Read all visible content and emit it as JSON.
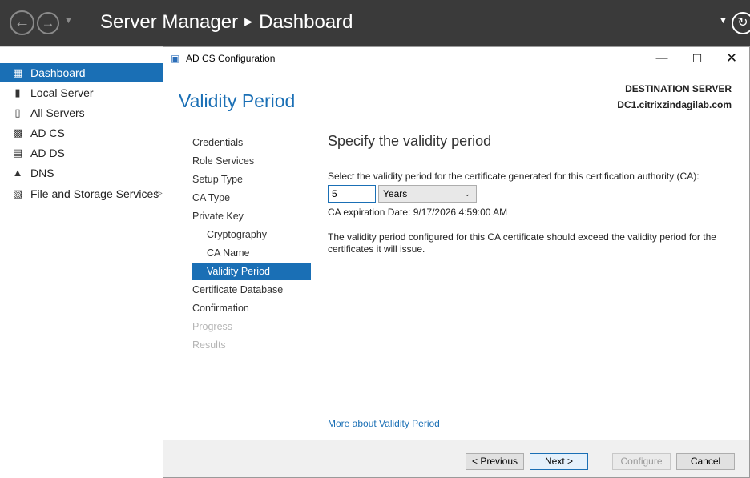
{
  "app": {
    "title_app": "Server Manager",
    "title_page": "Dashboard"
  },
  "sidebar": {
    "items": [
      {
        "label": "Dashboard",
        "icon": "dashboard-grid-icon",
        "active": true
      },
      {
        "label": "Local Server",
        "icon": "server-icon"
      },
      {
        "label": "All Servers",
        "icon": "servers-icon"
      },
      {
        "label": "AD CS",
        "icon": "certificate-icon"
      },
      {
        "label": "AD DS",
        "icon": "directory-icon"
      },
      {
        "label": "DNS",
        "icon": "dns-icon"
      },
      {
        "label": "File and Storage Services",
        "icon": "storage-icon",
        "has_submenu": true
      }
    ]
  },
  "dialog": {
    "title": "AD CS Configuration",
    "heading": "Validity Period",
    "destination_label": "DESTINATION SERVER",
    "destination_server": "DC1.citrixzindagilab.com",
    "nav": [
      {
        "label": "Credentials",
        "state": "normal"
      },
      {
        "label": "Role Services",
        "state": "normal"
      },
      {
        "label": "Setup Type",
        "state": "normal"
      },
      {
        "label": "CA Type",
        "state": "normal"
      },
      {
        "label": "Private Key",
        "state": "normal"
      },
      {
        "label": "Cryptography",
        "state": "sub"
      },
      {
        "label": "CA Name",
        "state": "sub"
      },
      {
        "label": "Validity Period",
        "state": "sub-active"
      },
      {
        "label": "Certificate Database",
        "state": "normal"
      },
      {
        "label": "Confirmation",
        "state": "normal"
      },
      {
        "label": "Progress",
        "state": "disabled"
      },
      {
        "label": "Results",
        "state": "disabled"
      }
    ],
    "content": {
      "heading": "Specify the validity period",
      "instruction": "Select the validity period for the certificate generated for this certification authority (CA):",
      "validity_value": "5",
      "validity_unit": "Years",
      "expiration": "CA expiration Date: 9/17/2026 4:59:00 AM",
      "note": "The validity period configured for this CA certificate should exceed the validity period for the certificates it will issue.",
      "more_link": "More about Validity Period"
    },
    "buttons": {
      "previous": "< Previous",
      "next": "Next >",
      "configure": "Configure",
      "cancel": "Cancel"
    }
  },
  "colors": {
    "accent": "#1a6fb5",
    "titlebar": "#3a3a3a"
  }
}
